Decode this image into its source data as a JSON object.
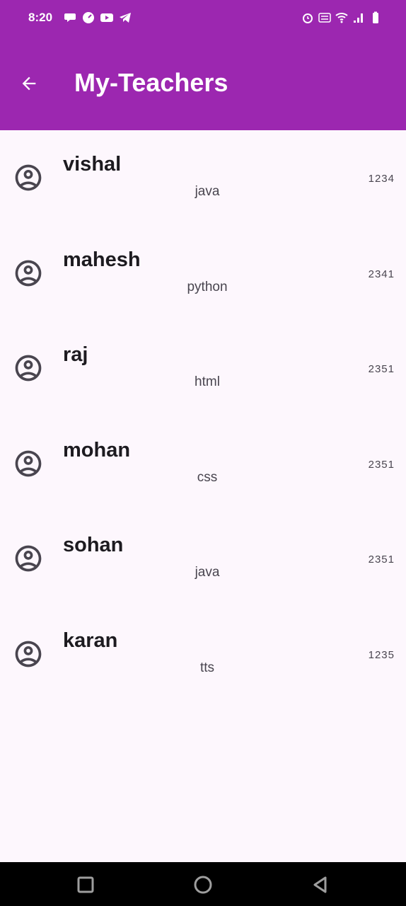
{
  "status_bar": {
    "time": "8:20",
    "left_icons": [
      "chat-icon",
      "speedometer-icon",
      "youtube-icon",
      "telegram-icon"
    ],
    "right_icons": [
      "alarm-icon",
      "volte-icon",
      "wifi-icon",
      "signal-icon",
      "battery-icon"
    ]
  },
  "app_bar": {
    "title": "My-Teachers",
    "color": "#9c27b0",
    "back_icon": "arrow-back-icon"
  },
  "teachers": [
    {
      "name": "vishal",
      "subject": "java",
      "code": "1234"
    },
    {
      "name": "mahesh",
      "subject": "python",
      "code": "2341"
    },
    {
      "name": "raj",
      "subject": "html",
      "code": "2351"
    },
    {
      "name": "mohan",
      "subject": "css",
      "code": "2351"
    },
    {
      "name": "sohan",
      "subject": "java",
      "code": "2351"
    },
    {
      "name": "karan",
      "subject": "tts",
      "code": "1235"
    }
  ],
  "nav_bar": {
    "buttons": [
      "recents-button",
      "home-button",
      "back-button"
    ]
  }
}
